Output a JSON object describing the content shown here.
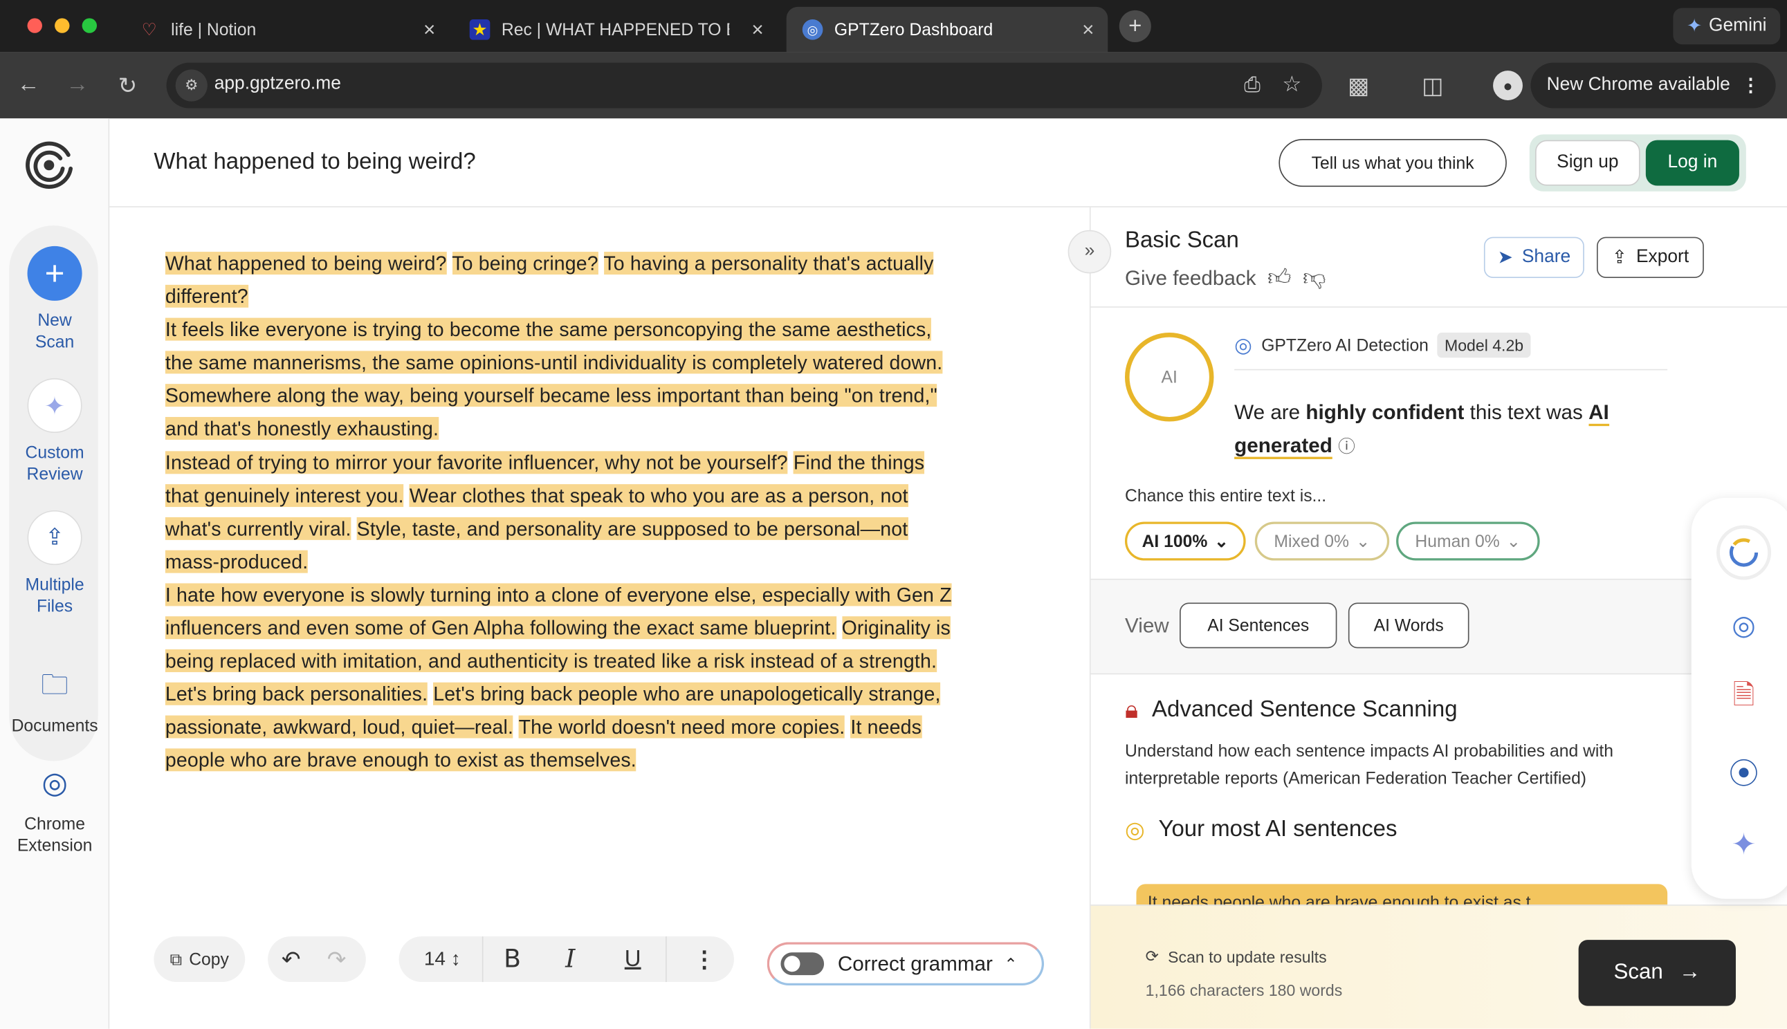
{
  "browser": {
    "tabs": [
      {
        "label": "life | Notion",
        "icon": "heart-icon"
      },
      {
        "label": "Rec | WHAT HAPPENED TO B",
        "icon": "star-icon"
      },
      {
        "label": "GPTZero Dashboard",
        "icon": "gptzero-icon"
      }
    ],
    "gemini_label": "Gemini",
    "url": "app.gptzero.me",
    "chrome_available": "New Chrome available"
  },
  "rail": {
    "new_scan": [
      "New",
      "Scan"
    ],
    "custom_review": [
      "Custom",
      "Review"
    ],
    "multiple_files": [
      "Multiple",
      "Files"
    ],
    "documents": "Documents",
    "chrome_extension": [
      "Chrome",
      "Extension"
    ]
  },
  "header": {
    "title": "What happened to being weird?",
    "feedback_btn": "Tell us what you think",
    "signup": "Sign up",
    "login": "Log in"
  },
  "editor": {
    "lines": [
      [
        "What happened to being weird?",
        " ",
        "To being cringe?",
        " ",
        "To having a personality that's actually"
      ],
      [
        "different?"
      ],
      [
        "It feels like everyone is trying to become the same personcopying the same aesthetics,"
      ],
      [
        "the same mannerisms, the same opinions-until individuality is completely watered down."
      ],
      [
        "Somewhere along the way, being yourself became less important than being \"on trend,\""
      ],
      [
        "and that's honestly exhausting."
      ],
      [
        "Instead of trying to mirror your favorite influencer, why not be yourself?",
        " ",
        "Find the things"
      ],
      [
        "that genuinely interest you.",
        " ",
        "Wear clothes that speak to who you are as a person, not"
      ],
      [
        "what's currently viral.",
        " ",
        "Style, taste, and personality are supposed to be personal—not"
      ],
      [
        "mass-produced."
      ],
      [
        "I hate how everyone is slowly turning into a clone of everyone else, especially with Gen Z"
      ],
      [
        "influencers and even some of Gen Alpha following the exact same blueprint.",
        " ",
        "Originality is"
      ],
      [
        "being replaced with imitation, and authenticity is treated like a risk instead of a strength."
      ],
      [
        "Let's bring back personalities.",
        " ",
        "Let's bring back people who are unapologetically strange,"
      ],
      [
        "passionate, awkward, loud, quiet—real.",
        " ",
        "The world doesn't need more copies.",
        " ",
        "It needs"
      ],
      [
        "people who are brave enough to exist as themselves."
      ]
    ],
    "copy": "Copy",
    "font_size": "14",
    "grammar": "Correct grammar"
  },
  "panel": {
    "title": "Basic Scan",
    "give_feedback": "Give feedback",
    "share": "Share",
    "export": "Export",
    "ai_circle": "AI",
    "detector": "GPTZero AI Detection",
    "model": "Model 4.2b",
    "confident_pre": "We are ",
    "confident_bold": "highly confident",
    "confident_mid": " this text was ",
    "confident_ai": "AI",
    "confident_gen": "generated",
    "chance": "Chance this entire text is...",
    "chips": [
      {
        "label": "AI 100%",
        "color": "#e8b62a",
        "text": "#222"
      },
      {
        "label": "Mixed 0%",
        "color": "#d6c98a",
        "text": "#888"
      },
      {
        "label": "Human 0%",
        "color": "#5fa77f",
        "text": "#888"
      }
    ],
    "view_label": "View",
    "view_buttons": [
      "AI Sentences",
      "AI Words"
    ],
    "adv_title": "Advanced Sentence Scanning",
    "adv_text": "Understand how each sentence impacts AI probabilities and with interpretable reports (American Federation Teacher Certified)",
    "most_title": "Your most AI sentences",
    "sentence_preview": "It needs people who are brave enough to exist as t",
    "scan_update": "Scan to update results",
    "chars_words": "1,166 characters 180 words",
    "scan_btn": "Scan"
  },
  "colors": {
    "highlight": "#f8d78f",
    "brand_green": "#0f6b40",
    "ai_yellow": "#e8b62a",
    "link_blue": "#2a5aa8"
  }
}
